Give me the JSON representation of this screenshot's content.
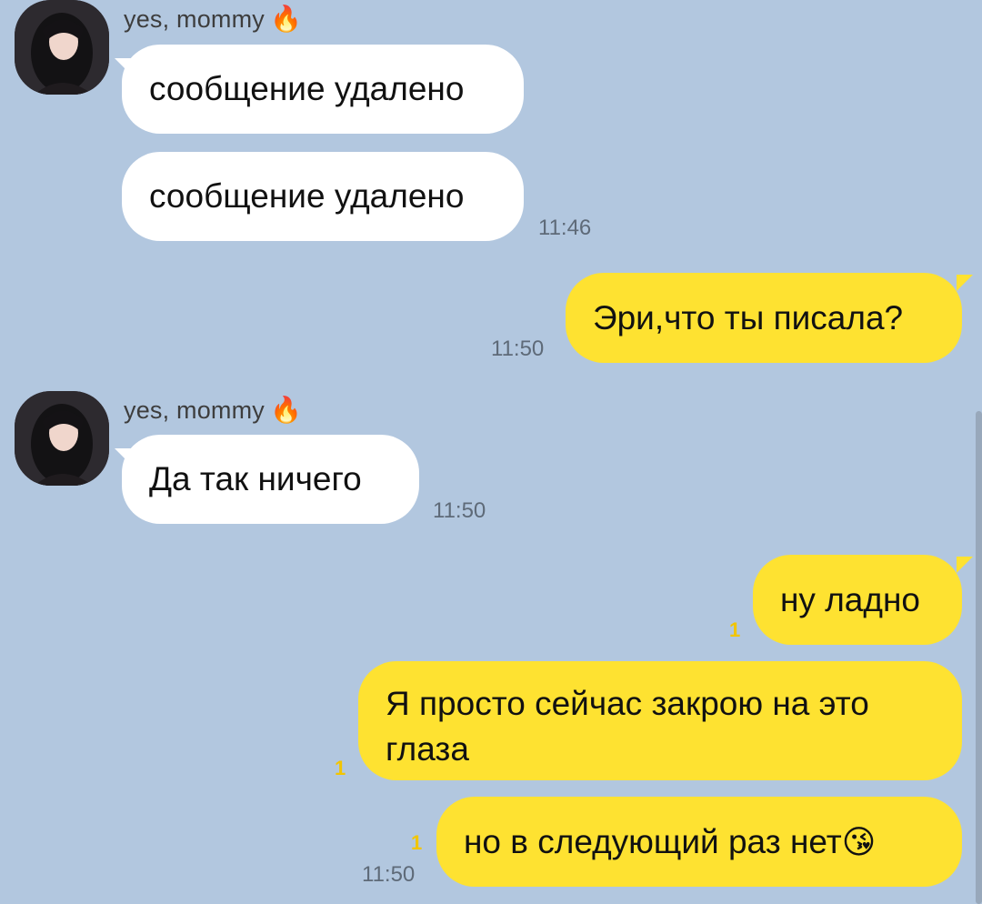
{
  "chat": {
    "contact_name": "yes, mommy",
    "contact_emoji": "🔥",
    "messages": [
      {
        "side": "in",
        "text": "сообщение удалено"
      },
      {
        "side": "in",
        "text": "сообщение удалено",
        "time": "11:46"
      },
      {
        "side": "out",
        "text": "Эри,что ты писала?",
        "time": "11:50"
      },
      {
        "side": "in",
        "text": "Да так ничего",
        "time": "11:50"
      },
      {
        "side": "out",
        "text": "ну ладно",
        "unread": "1"
      },
      {
        "side": "out",
        "text": "Я просто сейчас закрою на это глаза",
        "unread": "1"
      },
      {
        "side": "out",
        "text": "но в следующий раз нет",
        "emoji": "😘",
        "unread": "1",
        "time": "11:50"
      }
    ]
  },
  "colors": {
    "background": "#b2c7df",
    "incoming_bubble": "#ffffff",
    "outgoing_bubble": "#fee231",
    "unread_count": "#f2c500",
    "timestamp": "#5e6a78"
  },
  "icons": {
    "avatar": "profile-photo-icon",
    "fire": "fire-emoji-icon",
    "kiss": "kissing-face-emoji-icon"
  }
}
